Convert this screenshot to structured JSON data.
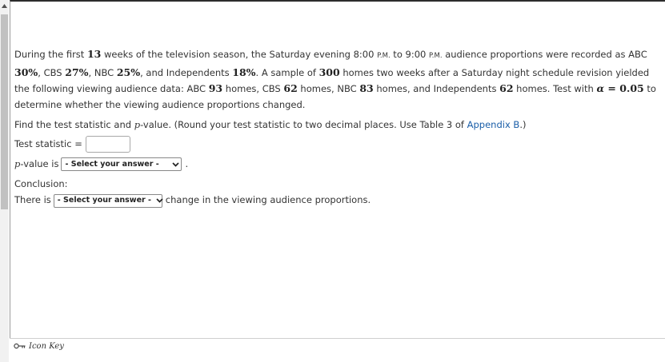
{
  "problem": {
    "p1_a": "During the first ",
    "weeks": "13",
    "p1_b": " weeks of the television season, the Saturday evening 8:00 ",
    "pm1": "P.M.",
    "p1_c": " to 9:00 ",
    "pm2": "P.M.",
    "p1_d": " audience proportions were recorded as ABC ",
    "abc_pct": "30%",
    "p1_e": ", CBS ",
    "cbs_pct": "27%",
    "p1_f": ", NBC ",
    "nbc_pct": "25%",
    "p1_g": ", and Independents ",
    "ind_pct": "18%",
    "p1_h": ". A sample of ",
    "sample": "300",
    "p1_i": " homes two weeks after a Saturday night schedule revision yielded the following viewing audience data: ABC ",
    "abc_homes": "93",
    "p1_j": " homes, CBS ",
    "cbs_homes": "62",
    "p1_k": " homes, NBC ",
    "nbc_homes": "83",
    "p1_l": " homes, and Independents ",
    "ind_homes": "62",
    "p1_m": " homes. Test with ",
    "alpha_sym": "α",
    "alpha_eq": " = ",
    "alpha_val": "0.05",
    "p1_n": " to determine whether the viewing audience proportions changed."
  },
  "instruction": {
    "a": "Find the test statistic and ",
    "p": "p",
    "b": "-value. (Round your test statistic to two decimal places. Use Table 3 of ",
    "link": "Appendix B",
    "c": ".)"
  },
  "test_statistic": {
    "label": "Test statistic =",
    "value": ""
  },
  "p_value": {
    "p": "p",
    "label": "-value is",
    "select_value": "- Select your answer -",
    "after": "."
  },
  "conclusion": {
    "label": "Conclusion:",
    "before": "There is",
    "select_value": "- Select your answer -",
    "after": "change in the viewing audience proportions."
  },
  "footer": {
    "icon_key": "Icon Key"
  }
}
